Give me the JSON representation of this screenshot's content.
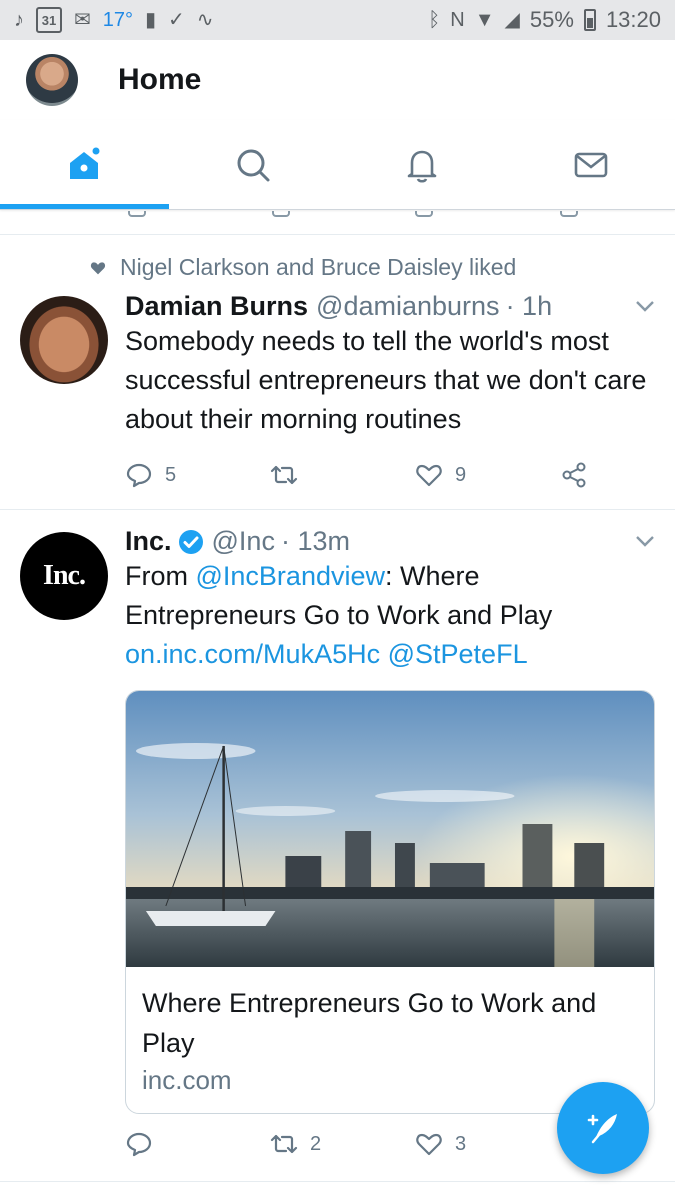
{
  "statusbar": {
    "calendar_day": "31",
    "temperature": "17°",
    "battery": "55%",
    "time": "13:20"
  },
  "header": {
    "title": "Home"
  },
  "tabs": [
    {
      "name": "home",
      "icon": "home-icon",
      "active": true
    },
    {
      "name": "search",
      "icon": "search-icon",
      "active": false
    },
    {
      "name": "notifications",
      "icon": "bell-icon",
      "active": false
    },
    {
      "name": "messages",
      "icon": "mail-icon",
      "active": false
    }
  ],
  "tweets": [
    {
      "social_context": "Nigel Clarkson and Bruce Daisley liked",
      "name": "Damian Burns",
      "handle": "@damianburns",
      "time": "· 1h",
      "text": "Somebody needs to tell the world's most successful entrepreneurs that we don't care about their morning routines",
      "replies": "5",
      "retweets": "",
      "likes": "9"
    },
    {
      "name": "Inc.",
      "avatar_text": "Inc.",
      "verified": true,
      "handle": "@Inc",
      "time": "· 13m",
      "text_prefix": "From ",
      "mention_1": "@IncBrandview",
      "text_middle": ": Where Entrepreneurs Go to Work and Play",
      "url": "on.inc.com/MukA5Hc",
      "mention_2": "@StPeteFL",
      "card": {
        "title": "Where Entrepreneurs Go to Work and Play",
        "domain": "inc.com"
      },
      "replies": "",
      "retweets": "2",
      "likes": "3"
    }
  ],
  "colors": {
    "accent": "#1da1f2",
    "link": "#1b95e0",
    "muted": "#657786"
  }
}
